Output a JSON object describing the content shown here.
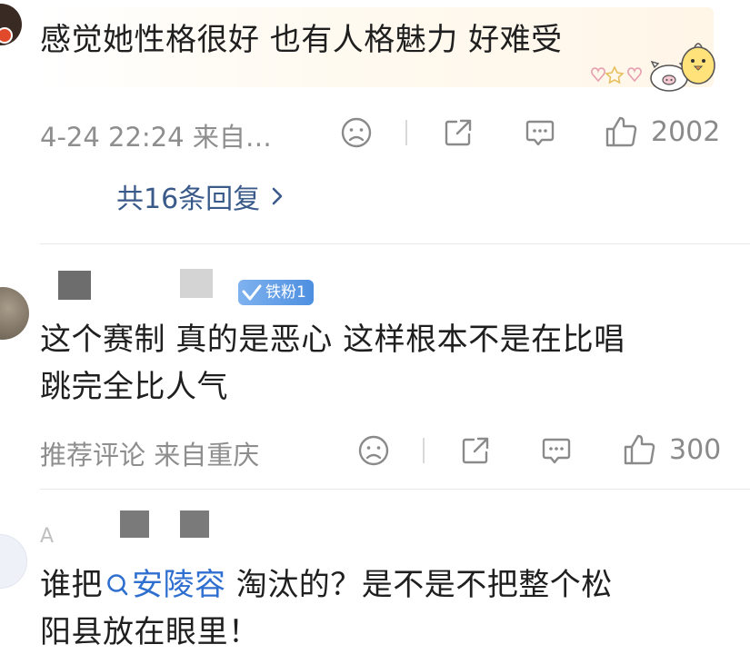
{
  "comments": [
    {
      "text": "感觉她性格很好 也有人格魅力 好难受",
      "meta": "4-24 22:24 来自…",
      "likes": "2002",
      "replies_link": "共16条回复"
    },
    {
      "badge": "铁粉1",
      "line1": "这个赛制 真的是恶心 这样根本不是在比唱",
      "line2": "跳完全比人气",
      "meta": "推荐评论 来自重庆",
      "likes": "300"
    },
    {
      "username_partial": "A",
      "prefix": "谁把",
      "mention": "安陵容",
      "suffix": " 淘汰的？是不是不把整个松",
      "line2": "阳县放在眼里！"
    }
  ],
  "icons": {
    "dislike": "sad-face-icon",
    "share": "share-icon",
    "comment": "comment-bubble-icon",
    "like": "thumbs-up-icon",
    "chevron": "chevron-right-icon",
    "search": "search-icon"
  },
  "colors": {
    "link": "#3a5a8a",
    "mention": "#2f6fd0",
    "badge": "#5a97e6",
    "meta": "#8e8e8e"
  }
}
